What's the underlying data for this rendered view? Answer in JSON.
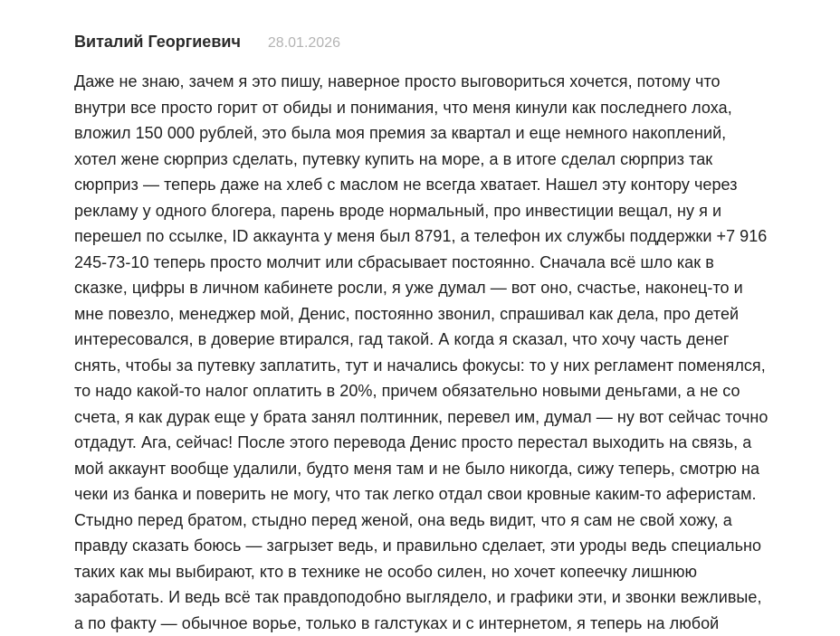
{
  "review": {
    "author": "Виталий Георгиевич",
    "date": "28.01.2026",
    "lines": [
      "Даже не знаю, зачем я это пишу, наверное просто выговориться хочется, потому что",
      "внутри все просто горит от обиды и понимания, что меня кинули как последнего лоха,",
      "вложил 150 000 рублей, это была моя премия за квартал и еще немного накоплений,",
      "хотел жене сюрприз сделать, путевку купить на море, а в итоге сделал сюрприз так",
      "сюрприз — теперь даже на хлеб с маслом не всегда хватает. Нашел эту контору через",
      "рекламу у одного блогера, парень вроде нормальный, про инвестиции вещал, ну я и",
      "перешел по ссылке, ID аккаунта у меня был 8791, а телефон их службы поддержки +7 916",
      "245-73-10 теперь просто молчит или сбрасывает постоянно. Сначала всё шло как в",
      "сказке, цифры в личном кабинете росли, я уже думал — вот оно, счастье, наконец-то и",
      "мне повезло, менеджер мой, Денис, постоянно звонил, спрашивал как дела, про детей",
      "интересовался, в доверие втирался, гад такой. А когда я сказал, что хочу часть денег",
      "снять, чтобы за путевку заплатить, тут и начались фокусы: то у них регламент поменялся,",
      "то надо какой-то налог оплатить в 20%, причем обязательно новыми деньгами, а не со",
      "счета, я как дурак еще у брата занял полтинник, перевел им, думал — ну вот сейчас точно",
      "отдадут. Ага, сейчас! После этого перевода Денис просто перестал выходить на связь, а",
      "мой аккаунт вообще удалили, будто меня там и не было никогда, сижу теперь, смотрю на",
      "чеки из банка и поверить не могу, что так легко отдал свои кровные каким-то аферистам.",
      "Стыдно перед братом, стыдно перед женой, она ведь видит, что я сам не свой хожу, а",
      "правду сказать боюсь — загрызет ведь, и правильно сделает, эти уроды ведь специально",
      "таких как мы выбирают, кто в технике не особо силен, но хочет копеечку лишнюю",
      "заработать. И ведь всё так правдоподобно выглядело, и графики эти, и звонки вежливые,",
      "а по факту — обычное ворье, только в галстуках и с интернетом, я теперь на любой"
    ]
  }
}
